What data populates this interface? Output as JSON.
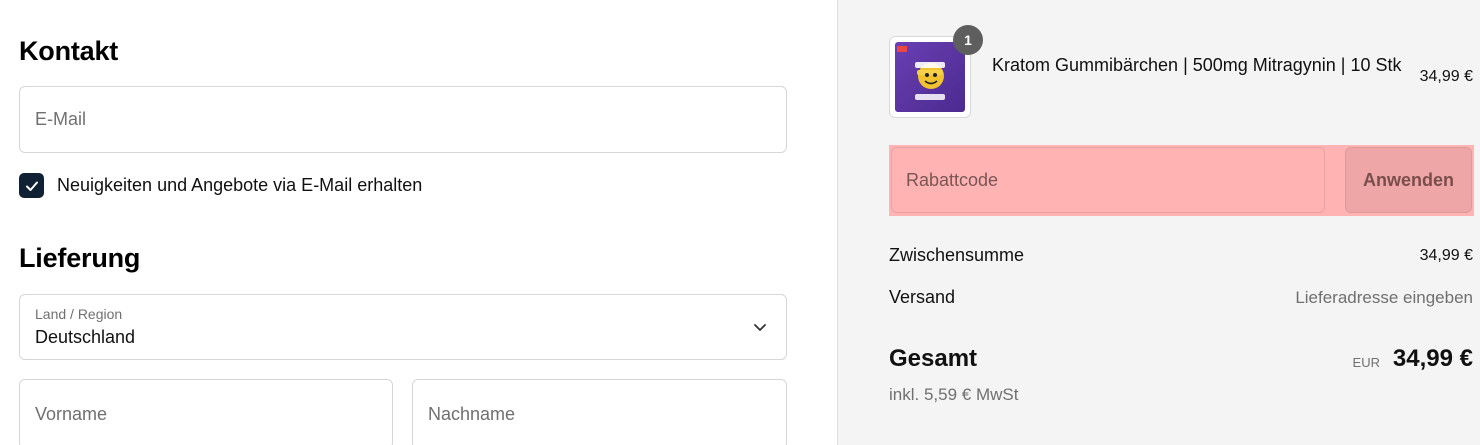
{
  "contact": {
    "heading": "Kontakt",
    "email_placeholder": "E-Mail",
    "newsletter_label": "Neuigkeiten und Angebote via E-Mail erhalten",
    "newsletter_checked": true
  },
  "delivery": {
    "heading": "Lieferung",
    "country_label": "Land / Region",
    "country_value": "Deutschland",
    "first_name_placeholder": "Vorname",
    "last_name_placeholder": "Nachname"
  },
  "summary": {
    "item": {
      "quantity": "1",
      "title": "Kratom Gummibärchen | 500mg Mitragynin | 10 Stk",
      "price": "34,99 €",
      "image_icon": "product-image"
    },
    "discount": {
      "placeholder": "Rabattcode",
      "apply_label": "Anwenden",
      "highlight_color": "#ffb3b3"
    },
    "subtotal_label": "Zwischensumme",
    "subtotal_value": "34,99 €",
    "shipping_label": "Versand",
    "shipping_value": "Lieferadresse eingeben",
    "total_label": "Gesamt",
    "total_currency": "EUR",
    "total_value": "34,99 €",
    "tax_note": "inkl. 5,59 € MwSt"
  },
  "colors": {
    "checkbox": "#0f2133",
    "summary_bg": "#f4f4f4"
  }
}
